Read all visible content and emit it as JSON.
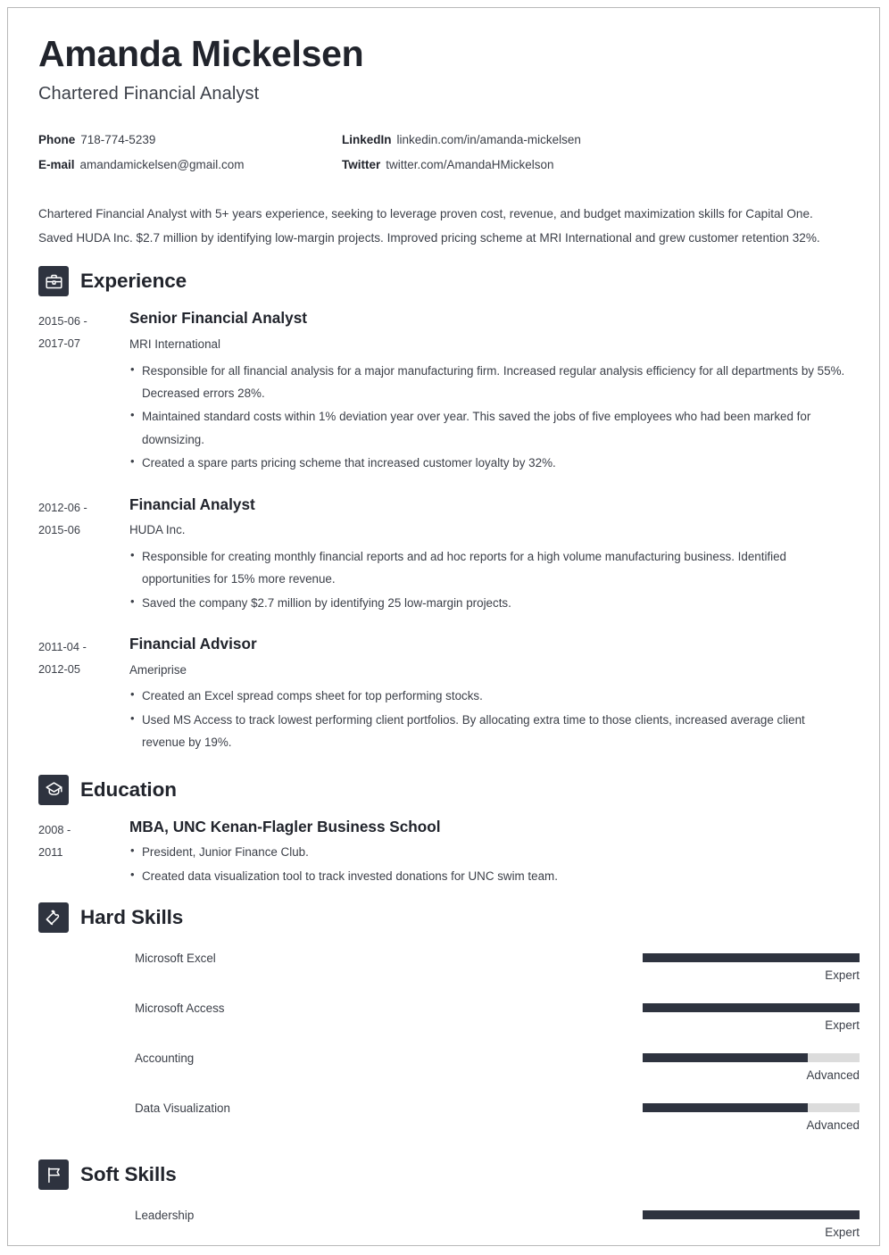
{
  "header": {
    "name": "Amanda Mickelsen",
    "job_title": "Chartered Financial Analyst",
    "contacts": [
      {
        "label": "Phone",
        "value": "718-774-5239"
      },
      {
        "label": "LinkedIn",
        "value": "linkedin.com/in/amanda-mickelsen"
      },
      {
        "label": "E-mail",
        "value": "amandamickelsen@gmail.com"
      },
      {
        "label": "Twitter",
        "value": "twitter.com/AmandaHMickelson"
      }
    ]
  },
  "summary": "Chartered Financial Analyst with 5+ years experience, seeking to leverage proven cost, revenue, and budget maximization skills for Capital One. Saved HUDA Inc. $2.7 million by identifying low-margin projects. Improved pricing scheme at MRI International and grew customer retention 32%.",
  "sections": {
    "experience": {
      "title": "Experience",
      "icon": "briefcase-icon",
      "entries": [
        {
          "date_start": "2015-06 -",
          "date_end": "2017-07",
          "role": "Senior Financial Analyst",
          "company": "MRI International",
          "bullets": [
            "Responsible for all financial analysis for a major manufacturing firm. Increased regular analysis efficiency for all departments by 55%. Decreased errors 28%.",
            "Maintained standard costs within 1% deviation year over year. This saved the jobs of five employees who had been marked for downsizing.",
            "Created a spare parts pricing scheme that increased customer loyalty by 32%."
          ]
        },
        {
          "date_start": "2012-06 -",
          "date_end": "2015-06",
          "role": "Financial Analyst",
          "company": "HUDA Inc.",
          "bullets": [
            "Responsible for creating monthly financial reports and ad hoc reports for a high volume manufacturing business. Identified opportunities for 15% more revenue.",
            "Saved the company $2.7 million by identifying 25 low-margin projects."
          ]
        },
        {
          "date_start": "2011-04 -",
          "date_end": "2012-05",
          "role": "Financial Advisor",
          "company": "Ameriprise",
          "bullets": [
            "Created an Excel spread comps sheet for top performing stocks.",
            "Used MS Access to track lowest performing client portfolios. By allocating extra time to those clients, increased average client revenue by 19%."
          ]
        }
      ]
    },
    "education": {
      "title": "Education",
      "icon": "graduation-cap-icon",
      "entries": [
        {
          "date_start": "2008 -",
          "date_end": "2011",
          "degree": "MBA, UNC Kenan-Flagler Business School",
          "bullets": [
            "President, Junior Finance Club.",
            "Created data visualization tool to track invested donations for UNC swim team."
          ]
        }
      ]
    },
    "hard_skills": {
      "title": "Hard Skills",
      "icon": "puzzle-piece-icon",
      "skills": [
        {
          "name": "Microsoft Excel",
          "level": "Expert",
          "percent": 100
        },
        {
          "name": "Microsoft Access",
          "level": "Expert",
          "percent": 100
        },
        {
          "name": "Accounting",
          "level": "Advanced",
          "percent": 76
        },
        {
          "name": "Data Visualization",
          "level": "Advanced",
          "percent": 76
        }
      ]
    },
    "soft_skills": {
      "title": "Soft Skills",
      "icon": "flag-icon",
      "skills": [
        {
          "name": "Leadership",
          "level": "Expert",
          "percent": 100
        }
      ]
    }
  },
  "colors": {
    "accent_dark": "#2e333f",
    "text": "#3b3f48",
    "heading": "#21242c",
    "bar_track": "#dcdcdc",
    "page_border": "#b8b8b8"
  }
}
